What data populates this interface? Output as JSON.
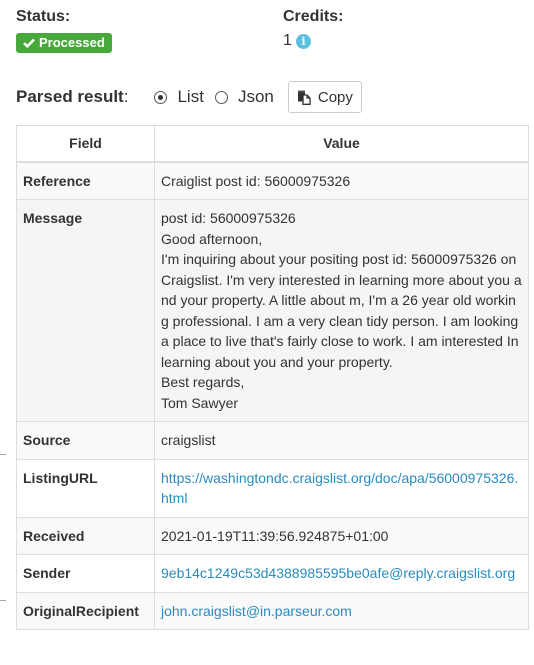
{
  "status": {
    "label": "Status:",
    "badge_text": "Processed",
    "badge_icon": "check-icon",
    "badge_color": "#47a93a"
  },
  "credits": {
    "label": "Credits:",
    "value": "1",
    "info_icon": "info-icon",
    "info_glyph": "i",
    "info_color": "#5bc0de"
  },
  "parsed_result": {
    "label": "Parsed result",
    "colon": ":",
    "options": [
      {
        "label": "List",
        "selected": true
      },
      {
        "label": "Json",
        "selected": false
      }
    ],
    "copy_label": "Copy"
  },
  "table": {
    "headers": {
      "field": "Field",
      "value": "Value"
    },
    "rows": [
      {
        "field": "Reference",
        "value": "Craiglist post id: 56000975326"
      },
      {
        "field": "Message",
        "lines": [
          "post id: 56000975326",
          "Good afternoon,",
          "I'm inquiring about your positing post id: 56000975326 on Craigslist. I'm very interested in learning more about you and your property. A little about m, I'm a 26 year old working professional. I am a very clean tidy person. I am looking a place to live that's fairly close to work. I am interested In learning about you and your property.",
          "Best regards,",
          "Tom Sawyer"
        ]
      },
      {
        "field": "Source",
        "value": "craigslist"
      },
      {
        "field": "ListingURL",
        "value": "https://washingtondc.craigslist.org/doc/apa/56000975326.html"
      },
      {
        "field": "Received",
        "value": "2021-01-19T11:39:56.924875+01:00"
      },
      {
        "field": "Sender",
        "value": "9eb14c1249c53d4388985595be0afe@reply.craigslist.org"
      },
      {
        "field": "OriginalRecipient",
        "value": "john.craigslist@in.parseur.com"
      }
    ]
  }
}
